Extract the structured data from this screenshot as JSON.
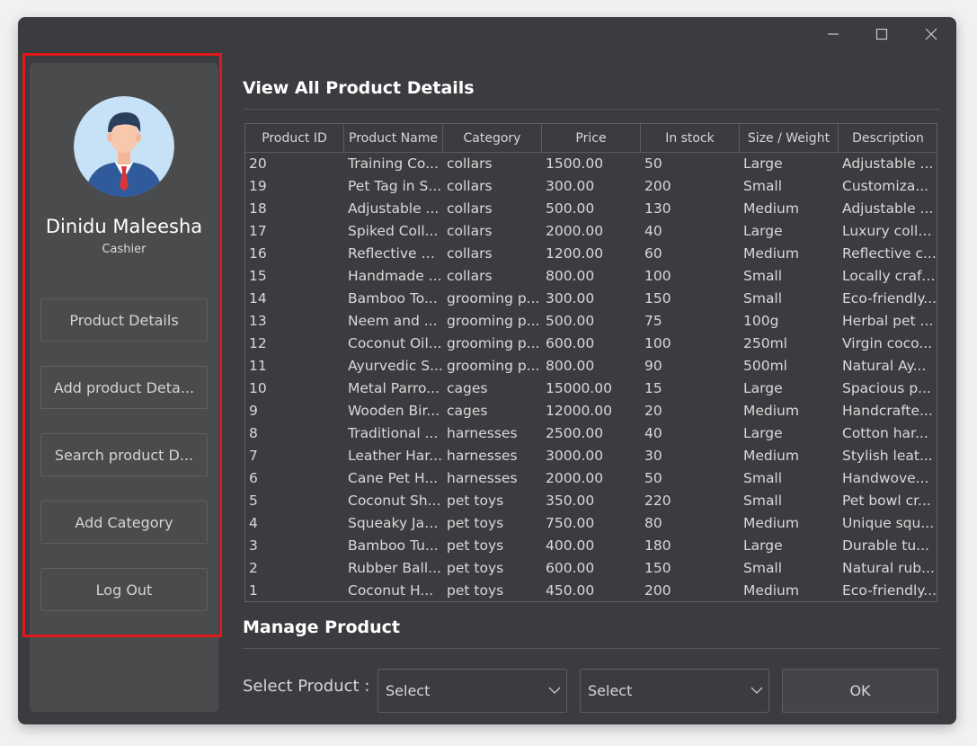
{
  "window": {
    "controls": [
      "minimize-icon",
      "maximize-icon",
      "close-icon"
    ]
  },
  "sidebar": {
    "user_name": "Dinidu Maleesha",
    "user_role": "Cashier",
    "nav": [
      {
        "label": "Product Details"
      },
      {
        "label": "Add product Deta..."
      },
      {
        "label": "Search product D..."
      },
      {
        "label": "Add Category"
      },
      {
        "label": "Log Out"
      }
    ]
  },
  "main": {
    "products_title": "View All Product Details",
    "table": {
      "columns": [
        "Product ID",
        "Product Name",
        "Category",
        "Price",
        "In stock",
        "Size / Weight",
        "Description"
      ],
      "rows": [
        [
          "20",
          "Training Co...",
          "collars",
          "1500.00",
          "50",
          "Large",
          "Adjustable ..."
        ],
        [
          "19",
          "Pet Tag in S...",
          "collars",
          "300.00",
          "200",
          "Small",
          "Customiza..."
        ],
        [
          "18",
          "Adjustable ...",
          "collars",
          "500.00",
          "130",
          "Medium",
          "Adjustable ..."
        ],
        [
          "17",
          "Spiked Coll...",
          "collars",
          "2000.00",
          "40",
          "Large",
          "Luxury colla..."
        ],
        [
          "16",
          "Reflective C...",
          "collars",
          "1200.00",
          "60",
          "Medium",
          "Reflective c..."
        ],
        [
          "15",
          "Handmade ...",
          "collars",
          "800.00",
          "100",
          "Small",
          "Locally craft..."
        ],
        [
          "14",
          "Bamboo To...",
          "grooming p...",
          "300.00",
          "150",
          "Small",
          "Eco-friendly..."
        ],
        [
          "13",
          "Neem and ...",
          "grooming p...",
          "500.00",
          "75",
          "100g",
          "Herbal pet ..."
        ],
        [
          "12",
          "Coconut Oil...",
          "grooming p...",
          "600.00",
          "100",
          "250ml",
          "Virgin coco..."
        ],
        [
          "11",
          "Ayurvedic S...",
          "grooming p...",
          "800.00",
          "90",
          "500ml",
          "Natural Ay..."
        ],
        [
          "10",
          "Metal Parro...",
          "cages",
          "15000.00",
          "15",
          "Large",
          "Spacious p..."
        ],
        [
          "9",
          "Wooden Bir...",
          "cages",
          "12000.00",
          "20",
          "Medium",
          "Handcrafte..."
        ],
        [
          "8",
          "Traditional ...",
          "harnesses",
          "2500.00",
          "40",
          "Large",
          "Cotton har..."
        ],
        [
          "7",
          "Leather Har...",
          "harnesses",
          "3000.00",
          "30",
          "Medium",
          "Stylish leat..."
        ],
        [
          "6",
          "Cane Pet H...",
          "harnesses",
          "2000.00",
          "50",
          "Small",
          "Handwove..."
        ],
        [
          "5",
          "Coconut Sh...",
          "pet toys",
          "350.00",
          "220",
          "Small",
          "Pet bowl cr..."
        ],
        [
          "4",
          "Squeaky Jac...",
          "pet toys",
          "750.00",
          "80",
          "Medium",
          "Unique squ..."
        ],
        [
          "3",
          "Bamboo Tu...",
          "pet toys",
          "400.00",
          "180",
          "Large",
          "Durable tu..."
        ],
        [
          "2",
          "Rubber Ball...",
          "pet toys",
          "600.00",
          "150",
          "Small",
          "Natural rub..."
        ],
        [
          "1",
          "Coconut H...",
          "pet toys",
          "450.00",
          "200",
          "Medium",
          "Eco-friendly..."
        ]
      ]
    },
    "manage_title": "Manage Product",
    "select_label": "Select Product :",
    "select1": "Select",
    "select2": "Select",
    "ok_label": "OK"
  },
  "colors": {
    "window_bg": "#3b3c3f",
    "sidebar_bg": "#4a4b4d",
    "highlight": "#e01818"
  }
}
